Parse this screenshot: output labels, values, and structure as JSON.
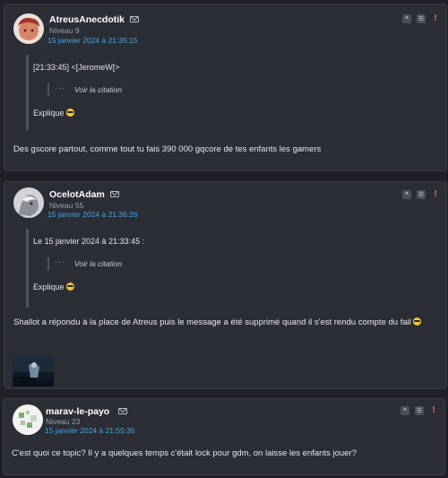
{
  "colors": {
    "page_bg": "#1f2126",
    "card_bg": "#2b2e35",
    "date_link": "#4aa3df",
    "alert": "#e05252"
  },
  "actions": {
    "quote_glyph": "❝",
    "menu_glyph": "☰",
    "alert_glyph": "!"
  },
  "posts": [
    {
      "author": "AtreusAnecdotik",
      "level": "Niveau 9",
      "date": "15 janvier 2024 à 21:35:15",
      "quote_first": "[21:33:45] <[JeromeW[>",
      "quote_link": "Voir la citation",
      "quote_last": "Explique",
      "message": "Des gscore partout, comme tout tu fais 390 000 gqcore de tes enfants les gamers"
    },
    {
      "author": "OcelotAdam",
      "level": "Niveau 55",
      "date": "15 janvier 2024 à 21:36:26",
      "quote_first": "Le 15 janvier 2024 à 21:33:45 :",
      "quote_link": "Voir la citation",
      "quote_last": "Explique",
      "message": "Shallot a répondu à la place de Atreus puis le message a été supprimé quand il s'est rendu compte du fail"
    },
    {
      "author": "marav-le-payo",
      "level": "Niveau 23",
      "date": "15 janvier 2024 à 21:55:35",
      "message": "C'est quoi ce topic? Il y a quelques temps c'était lock pour gdm, on laisse les enfants jouer?"
    }
  ]
}
